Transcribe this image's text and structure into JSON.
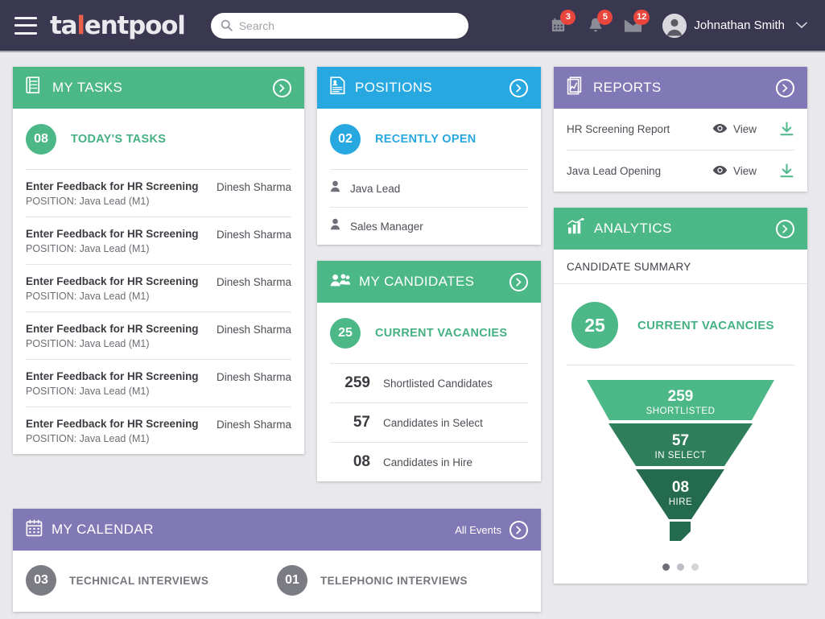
{
  "navbar": {
    "menu_icon": "hamburger-icon",
    "logo_pre": "ta",
    "logo_accent": "l",
    "logo_post": "entpool",
    "search_placeholder": "Search",
    "search_value": "",
    "calendar_badge": "3",
    "bell_badge": "5",
    "mail_badge": "12",
    "user_name": "Johnathan Smith",
    "caret": "▼"
  },
  "my_tasks": {
    "title": "MY TASKS",
    "icon": "tasks-list-icon",
    "counter": "08",
    "counter_label": "TODAY'S TASKS",
    "rows": [
      {
        "title": "Enter Feedback for HR Screening",
        "sub": "POSITION: Java Lead (M1)",
        "person": "Dinesh Sharma"
      },
      {
        "title": "Enter Feedback for HR Screening",
        "sub": "POSITION: Java Lead (M1)",
        "person": "Dinesh Sharma"
      },
      {
        "title": "Enter Feedback for HR Screening",
        "sub": "POSITION: Java Lead (M1)",
        "person": "Dinesh Sharma"
      },
      {
        "title": "Enter Feedback for HR Screening",
        "sub": "POSITION: Java Lead (M1)",
        "person": "Dinesh Sharma"
      },
      {
        "title": "Enter Feedback for HR Screening",
        "sub": "POSITION: Java Lead (M1)",
        "person": "Dinesh Sharma"
      },
      {
        "title": "Enter Feedback for HR Screening",
        "sub": "POSITION: Java Lead (M1)",
        "person": "Dinesh Sharma"
      }
    ]
  },
  "positions": {
    "title": "POSITIONS",
    "icon": "document-person-icon",
    "counter": "02",
    "counter_label": "RECENTLY OPEN",
    "items": [
      {
        "name": "Java Lead"
      },
      {
        "name": "Sales Manager"
      }
    ]
  },
  "my_candidates": {
    "title": "MY CANDIDATES",
    "icon": "people-group-icon",
    "counter": "25",
    "counter_label": "CURRENT VACANCIES",
    "stats": [
      {
        "num": "259",
        "text": "Shortlisted Candidates"
      },
      {
        "num": "57",
        "text": "Candidates in Select"
      },
      {
        "num": "08",
        "text": "Candidates in Hire"
      }
    ]
  },
  "reports": {
    "title": "REPORTS",
    "icon": "report-chart-icon",
    "view_label": "View",
    "rows": [
      {
        "name": "HR Screening Report"
      },
      {
        "name": "Java Lead Opening"
      }
    ]
  },
  "analytics": {
    "title": "ANALYTICS",
    "icon": "bar-chart-icon",
    "subtitle": "CANDIDATE SUMMARY",
    "counter": "25",
    "counter_label": "CURRENT VACANCIES",
    "dots": [
      {
        "color": "#6e6e76"
      },
      {
        "color": "#bdbdc4"
      },
      {
        "color": "#d4d4da"
      }
    ]
  },
  "my_calendar": {
    "title": "MY CALENDAR",
    "icon": "calendar-icon",
    "all_events": "All Events",
    "items": [
      {
        "count": "03",
        "label": "TECHNICAL INTERVIEWS"
      },
      {
        "count": "01",
        "label": "TELEPHONIC INTERVIEWS"
      }
    ]
  },
  "chart_data": {
    "type": "funnel",
    "title": "CANDIDATE SUMMARY",
    "stages": [
      {
        "label": "SHORTLISTED",
        "value": 259,
        "color": "#4cb887",
        "top_width": 232,
        "bottom_width": 178
      },
      {
        "label": "IN SELECT",
        "value": 57,
        "color": "#2f7f5d",
        "top_width": 174,
        "bottom_width": 110
      },
      {
        "label": "HIRE",
        "value": 8,
        "color": "#236a4e",
        "top_width": 106,
        "bottom_width": 28
      }
    ],
    "stem": {
      "color": "#236a4e",
      "width": 24,
      "height": 28
    },
    "legend_position": "none",
    "grid": false
  },
  "colors": {
    "navbar": "#3a3751",
    "green": "#4cb887",
    "blue": "#27a8e0",
    "purple": "#8179b5",
    "badge_red": "#e8453c",
    "logo_accent": "#e8604c",
    "page_bg": "#e9e9ed"
  }
}
